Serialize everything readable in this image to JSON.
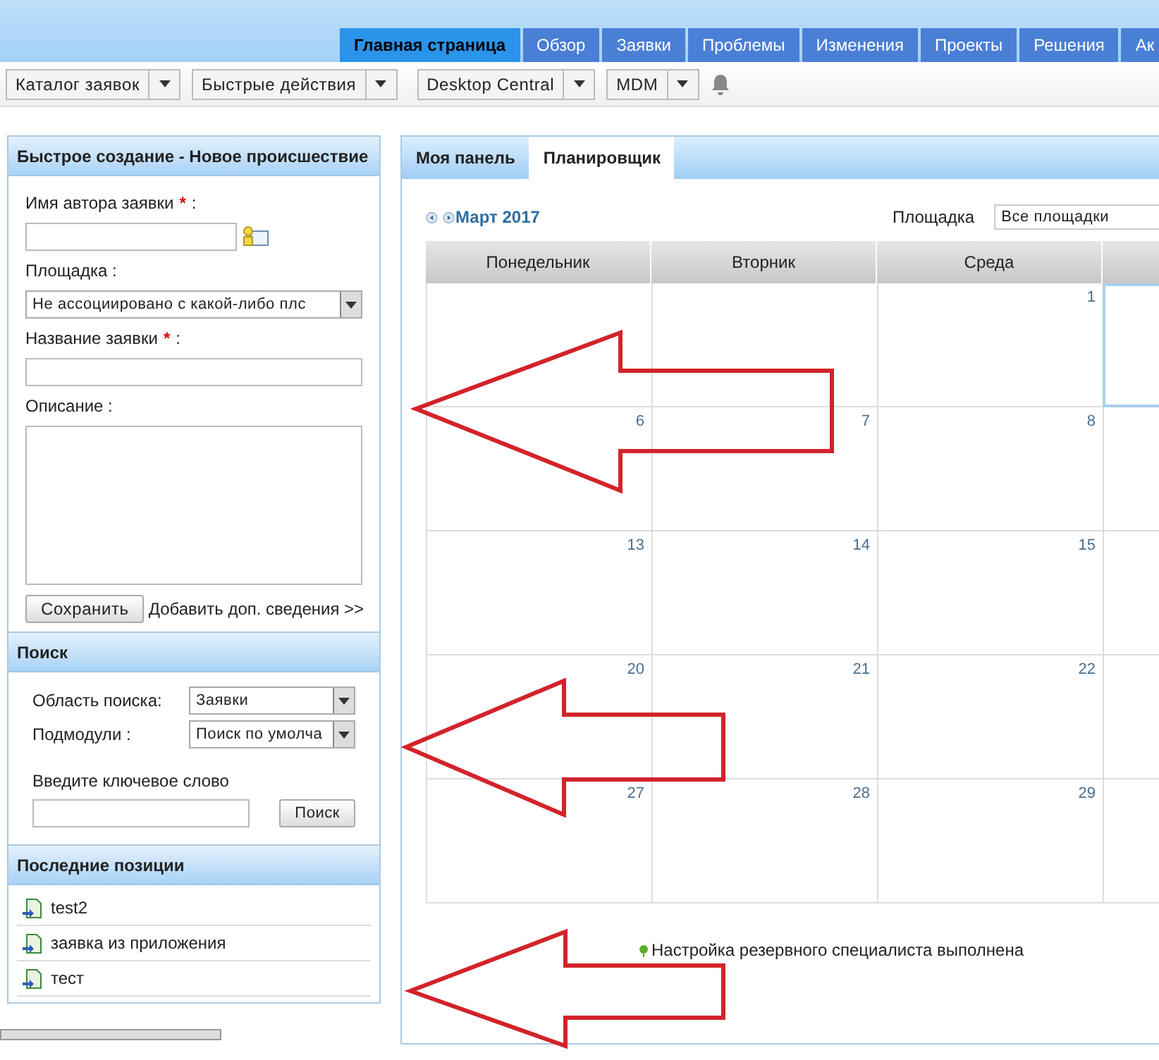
{
  "nav_tabs": [
    {
      "label": "Главная страница",
      "selected": true
    },
    {
      "label": "Обзор",
      "selected": false
    },
    {
      "label": "Заявки",
      "selected": false
    },
    {
      "label": "Проблемы",
      "selected": false
    },
    {
      "label": "Изменения",
      "selected": false
    },
    {
      "label": "Проекты",
      "selected": false
    },
    {
      "label": "Решения",
      "selected": false
    },
    {
      "label": "Ак",
      "selected": false
    }
  ],
  "toolbar": {
    "dropdowns": [
      "Каталог заявок",
      "Быстрые действия",
      "Desktop Central",
      "MDM"
    ]
  },
  "quick_create": {
    "title": "Быстрое создание - Новое происшествие",
    "requester_label": "Имя автора заявки",
    "site_label": "Площадка :",
    "site_value": "Не ассоциировано с какой-либо плс",
    "subject_label": "Название заявки",
    "required_mark": "*",
    "label_suffix": ":",
    "description_label": "Описание :",
    "save_button": "Сохранить",
    "more_link": "Добавить доп. сведения >>"
  },
  "search": {
    "title": "Поиск",
    "scope_label": "Область поиска:",
    "scope_value": "Заявки",
    "submodule_label": "Подмодули :",
    "submodule_value": "Поиск по умолча",
    "keyword_label": "Введите ключевое слово",
    "button": "Поиск"
  },
  "recent": {
    "title": "Последние позиции",
    "items": [
      "test2",
      "заявка из приложения",
      "тест"
    ]
  },
  "panel_tabs": [
    {
      "label": "Моя панель",
      "selected": false
    },
    {
      "label": "Планировщик",
      "selected": true
    }
  ],
  "calendar": {
    "month": "Март 2017",
    "site_label": "Площадка",
    "site_value": "Все площадки",
    "columns": [
      "Понедельник",
      "Вторник",
      "Среда"
    ],
    "weeks": [
      [
        {
          "selected": false
        },
        {
          "selected": false
        },
        {
          "day": "1",
          "selected": false
        },
        {
          "selected": true
        }
      ],
      [
        {
          "day": "6",
          "selected": false
        },
        {
          "day": "7",
          "selected": false
        },
        {
          "day": "8",
          "selected": false
        },
        {
          "selected": false
        }
      ],
      [
        {
          "day": "13",
          "selected": false
        },
        {
          "day": "14",
          "selected": false
        },
        {
          "day": "15",
          "selected": false
        },
        {
          "selected": false
        }
      ],
      [
        {
          "day": "20",
          "selected": false
        },
        {
          "day": "21",
          "selected": false
        },
        {
          "day": "22",
          "selected": false
        },
        {
          "selected": false
        }
      ],
      [
        {
          "day": "27",
          "selected": false
        },
        {
          "day": "28",
          "selected": false
        },
        {
          "day": "29",
          "selected": false
        },
        {
          "selected": false
        }
      ]
    ]
  },
  "status_message": "Настройка резервного специалиста выполнена"
}
